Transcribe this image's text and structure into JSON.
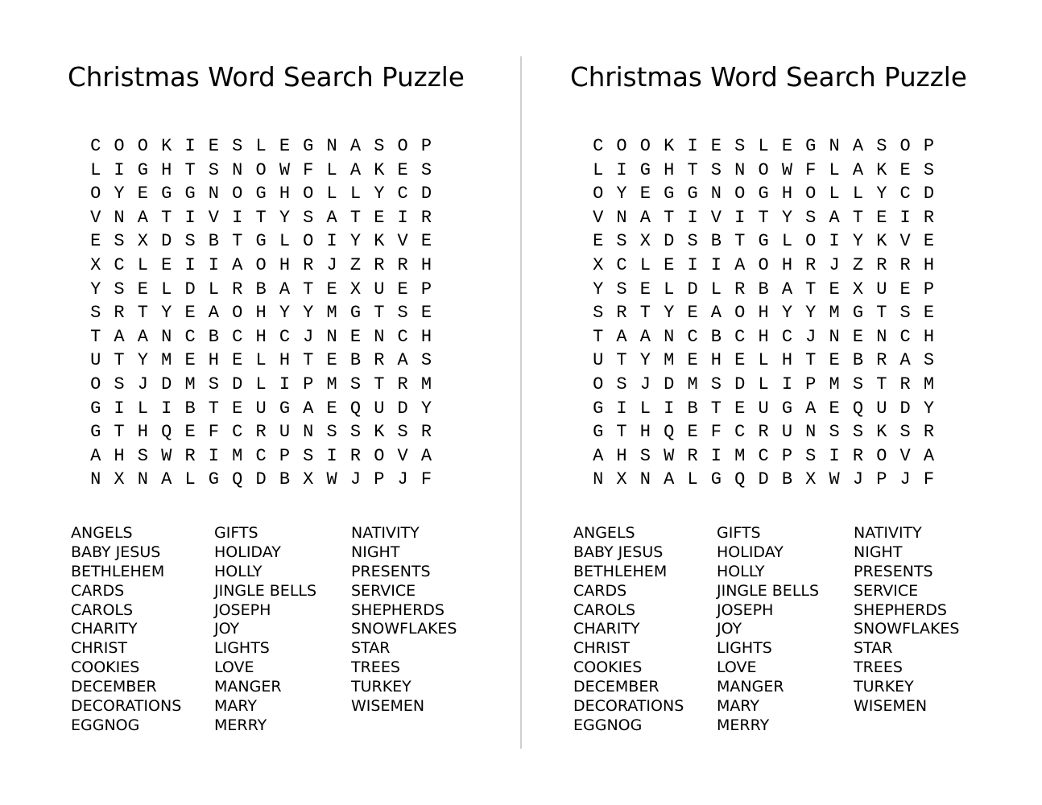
{
  "puzzle": {
    "title": "Christmas Word Search Puzzle",
    "grid": [
      [
        "C",
        "O",
        "O",
        "K",
        "I",
        "E",
        "S",
        "L",
        "E",
        "G",
        "N",
        "A",
        "S",
        "O",
        "P"
      ],
      [
        "L",
        "I",
        "G",
        "H",
        "T",
        "S",
        "N",
        "O",
        "W",
        "F",
        "L",
        "A",
        "K",
        "E",
        "S"
      ],
      [
        "O",
        "Y",
        "E",
        "G",
        "G",
        "N",
        "O",
        "G",
        "H",
        "O",
        "L",
        "L",
        "Y",
        "C",
        "D"
      ],
      [
        "V",
        "N",
        "A",
        "T",
        "I",
        "V",
        "I",
        "T",
        "Y",
        "S",
        "A",
        "T",
        "E",
        "I",
        "R"
      ],
      [
        "E",
        "S",
        "X",
        "D",
        "S",
        "B",
        "T",
        "G",
        "L",
        "O",
        "I",
        "Y",
        "K",
        "V",
        "E"
      ],
      [
        "X",
        "C",
        "L",
        "E",
        "I",
        "I",
        "A",
        "O",
        "H",
        "R",
        "J",
        "Z",
        "R",
        "R",
        "H"
      ],
      [
        "Y",
        "S",
        "E",
        "L",
        "D",
        "L",
        "R",
        "B",
        "A",
        "T",
        "E",
        "X",
        "U",
        "E",
        "P"
      ],
      [
        "S",
        "R",
        "T",
        "Y",
        "E",
        "A",
        "O",
        "H",
        "Y",
        "Y",
        "M",
        "G",
        "T",
        "S",
        "E"
      ],
      [
        "T",
        "A",
        "A",
        "N",
        "C",
        "B",
        "C",
        "H",
        "C",
        "J",
        "N",
        "E",
        "N",
        "C",
        "H"
      ],
      [
        "U",
        "T",
        "Y",
        "M",
        "E",
        "H",
        "E",
        "L",
        "H",
        "T",
        "E",
        "B",
        "R",
        "A",
        "S"
      ],
      [
        "O",
        "S",
        "J",
        "D",
        "M",
        "S",
        "D",
        "L",
        "I",
        "P",
        "M",
        "S",
        "T",
        "R",
        "M"
      ],
      [
        "G",
        "I",
        "L",
        "I",
        "B",
        "T",
        "E",
        "U",
        "G",
        "A",
        "E",
        "Q",
        "U",
        "D",
        "Y"
      ],
      [
        "G",
        "T",
        "H",
        "Q",
        "E",
        "F",
        "C",
        "R",
        "U",
        "N",
        "S",
        "S",
        "K",
        "S",
        "R"
      ],
      [
        "A",
        "H",
        "S",
        "W",
        "R",
        "I",
        "M",
        "C",
        "P",
        "S",
        "I",
        "R",
        "O",
        "V",
        "A"
      ],
      [
        "N",
        "X",
        "N",
        "A",
        "L",
        "G",
        "Q",
        "D",
        "B",
        "X",
        "W",
        "J",
        "P",
        "J",
        "F"
      ]
    ],
    "word_columns": [
      [
        "ANGELS",
        "BABY JESUS",
        "BETHLEHEM",
        "CARDS",
        "CAROLS",
        "CHARITY",
        "CHRIST",
        "COOKIES",
        "DECEMBER",
        "DECORATIONS",
        "EGGNOG"
      ],
      [
        "GIFTS",
        "HOLIDAY",
        "HOLLY",
        "JINGLE BELLS",
        "JOSEPH",
        "JOY",
        "LIGHTS",
        "LOVE",
        "MANGER",
        "MARY",
        "MERRY"
      ],
      [
        "NATIVITY",
        "NIGHT",
        "PRESENTS",
        "SERVICE",
        "SHEPHERDS",
        "SNOWFLAKES",
        "STAR",
        "TREES",
        "TURKEY",
        "WISEMEN"
      ]
    ]
  },
  "colors": {
    "text": "#000000",
    "background": "#ffffff",
    "divider": "#cfcfcf"
  }
}
